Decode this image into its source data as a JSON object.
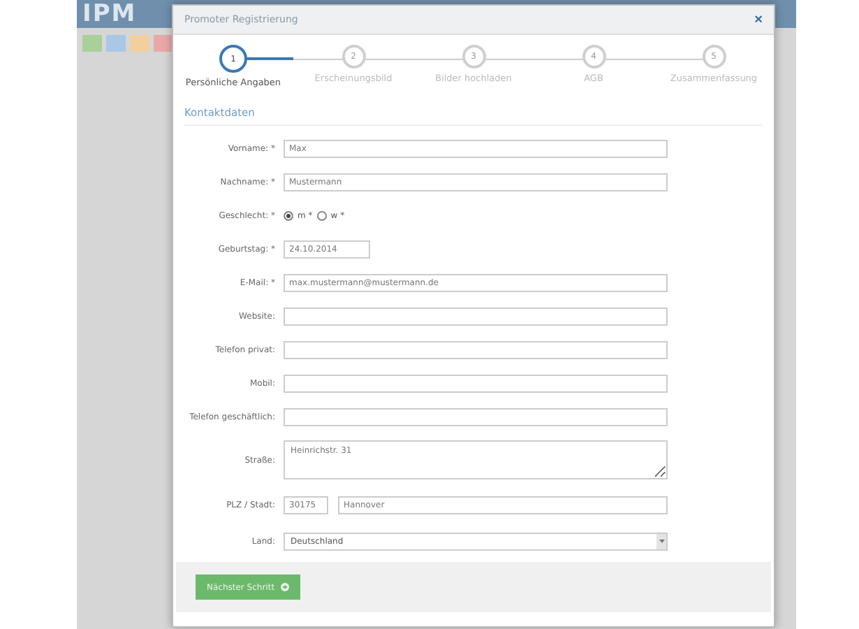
{
  "background": {
    "logo": "IPM",
    "toolbar": [
      {
        "color": "#a9cf9a"
      },
      {
        "color": "#a8c8e6"
      },
      {
        "color": "#f3cf9e"
      },
      {
        "color": "#e9a8a8"
      }
    ]
  },
  "dialog": {
    "title": "Promoter Registrierung",
    "close": "×",
    "steps": [
      {
        "number": "1",
        "label": "Persönliche Angaben",
        "selected": true
      },
      {
        "number": "2",
        "label": "Erscheinungsbild",
        "selected": false
      },
      {
        "number": "3",
        "label": "Bilder hochladen",
        "selected": false
      },
      {
        "number": "4",
        "label": "AGB",
        "selected": false
      },
      {
        "number": "5",
        "label": "Zusammenfassung",
        "selected": false
      }
    ],
    "section": "Kontaktdaten",
    "fields": [
      {
        "kind": "text",
        "label": "Vorname: *",
        "value": "Max"
      },
      {
        "kind": "text",
        "label": "Nachname: *",
        "value": "Mustermann"
      },
      {
        "kind": "radio",
        "label": "Geschlecht: *",
        "options": [
          {
            "label": "m *",
            "selected": true
          },
          {
            "label": "w *",
            "selected": false
          }
        ]
      },
      {
        "kind": "date",
        "label": "Geburtstag: *",
        "value": "24.10.2014"
      },
      {
        "kind": "text",
        "label": "E-Mail: *",
        "value": "max.mustermann@mustermann.de"
      },
      {
        "kind": "text",
        "label": "Website:"
      },
      {
        "kind": "text",
        "label": "Telefon privat:"
      },
      {
        "kind": "text",
        "label": "Mobil:"
      },
      {
        "kind": "text",
        "label": "Telefon geschäftlich:"
      },
      {
        "kind": "textarea",
        "label": "Straße:",
        "value": "Heinrichstr. 31"
      },
      {
        "kind": "plz",
        "label": "PLZ /  Stadt:",
        "value": "30175",
        "value2": "Hannover"
      },
      {
        "kind": "select",
        "label": "Land:",
        "value": "Deutschland"
      }
    ],
    "next_button": "Nächster Schritt"
  }
}
